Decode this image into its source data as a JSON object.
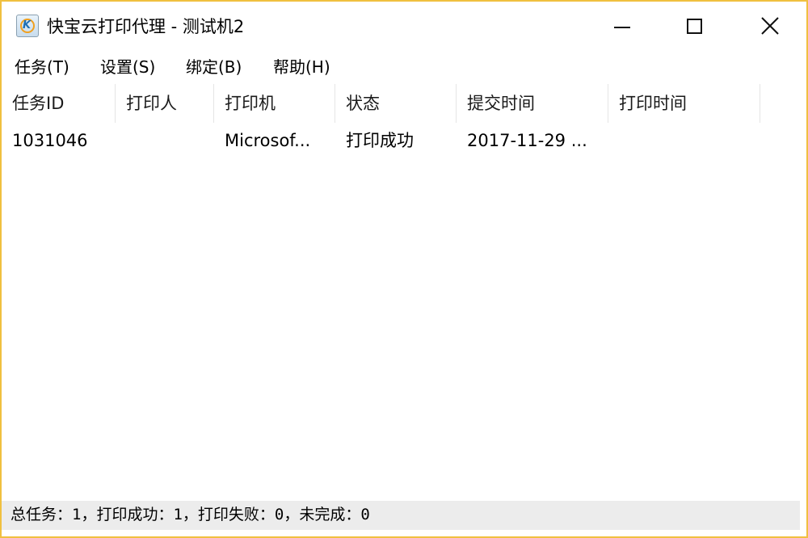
{
  "window": {
    "title": "快宝云打印代理 - 测试机2",
    "icon": "kuaibao-app-icon",
    "controls": {
      "minimize_icon": "minimize-icon",
      "maximize_icon": "maximize-icon",
      "close_icon": "close-icon"
    },
    "border_color": "#f0c040"
  },
  "menu": {
    "items": [
      {
        "label": "任务(T)"
      },
      {
        "label": "设置(S)"
      },
      {
        "label": "绑定(B)"
      },
      {
        "label": "帮助(H)"
      }
    ]
  },
  "table": {
    "columns": [
      "任务ID",
      "打印人",
      "打印机",
      "状态",
      "提交时间",
      "打印时间"
    ],
    "rows": [
      [
        "1031046",
        "",
        "Microsof...",
        "打印成功",
        "2017-11-29 ...",
        ""
      ]
    ]
  },
  "statusbar": {
    "text": "总任务：1，打印成功：1，打印失败：0，未完成：0"
  }
}
